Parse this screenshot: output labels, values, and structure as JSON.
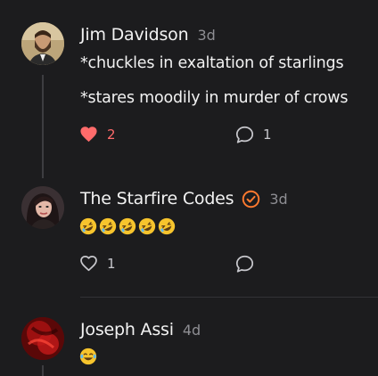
{
  "comments": [
    {
      "author": "Jim Davidson",
      "time": "3d",
      "lines": [
        "*chuckles in exaltation of starlings",
        "*stares moodily in murder of crows"
      ],
      "like_count": "2",
      "liked": true,
      "reply_count": "1",
      "avatar_icon": "bearded-man-avatar"
    },
    {
      "author": "The Starfire Codes",
      "time": "3d",
      "verified": true,
      "emoji_line": [
        "rofl",
        "rofl",
        "rofl",
        "rofl",
        "rofl"
      ],
      "like_count": "1",
      "liked": false,
      "avatar_icon": "woman-avatar"
    },
    {
      "author": "Joseph Assi",
      "time": "4d",
      "emoji_line": [
        "joy"
      ],
      "avatar_icon": "red-abstract-avatar"
    }
  ],
  "colors": {
    "background": "#1c1c1e",
    "liked_red": "#ff6b6b",
    "verified_orange": "#ff7a2f",
    "muted": "#8e8e93"
  }
}
